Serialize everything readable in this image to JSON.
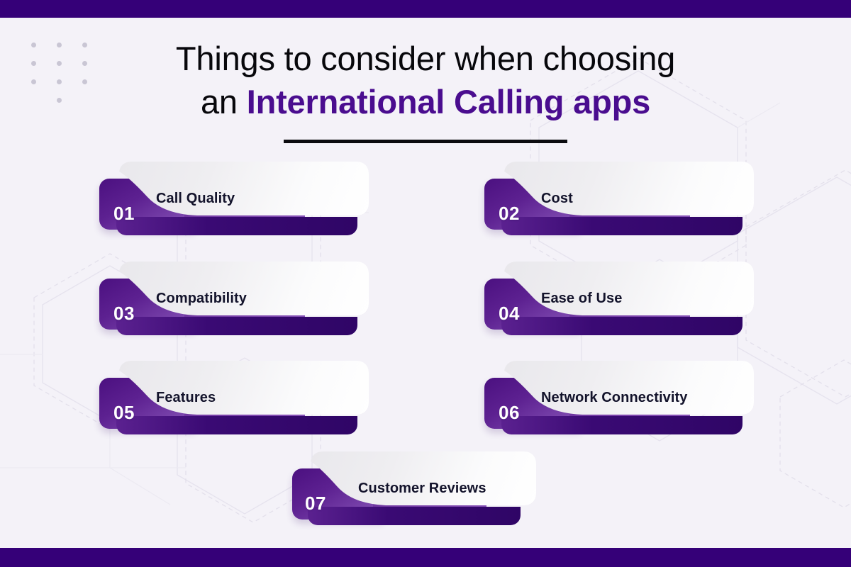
{
  "page": {
    "background_color": "#f4f2f8",
    "band_color": "#350078",
    "accent_color": "#4a0d8f",
    "card_text_color": "#13132b"
  },
  "title": {
    "line1": "Things to consider when choosing",
    "line2_prefix": "an ",
    "line2_accent": "International Calling apps"
  },
  "cards": [
    {
      "number": "01",
      "label": "Call Quality"
    },
    {
      "number": "02",
      "label": "Cost"
    },
    {
      "number": "03",
      "label": "Compatibility"
    },
    {
      "number": "04",
      "label": "Ease of Use"
    },
    {
      "number": "05",
      "label": "Features"
    },
    {
      "number": "06",
      "label": "Network Connectivity"
    },
    {
      "number": "07",
      "label": "Customer Reviews"
    }
  ]
}
